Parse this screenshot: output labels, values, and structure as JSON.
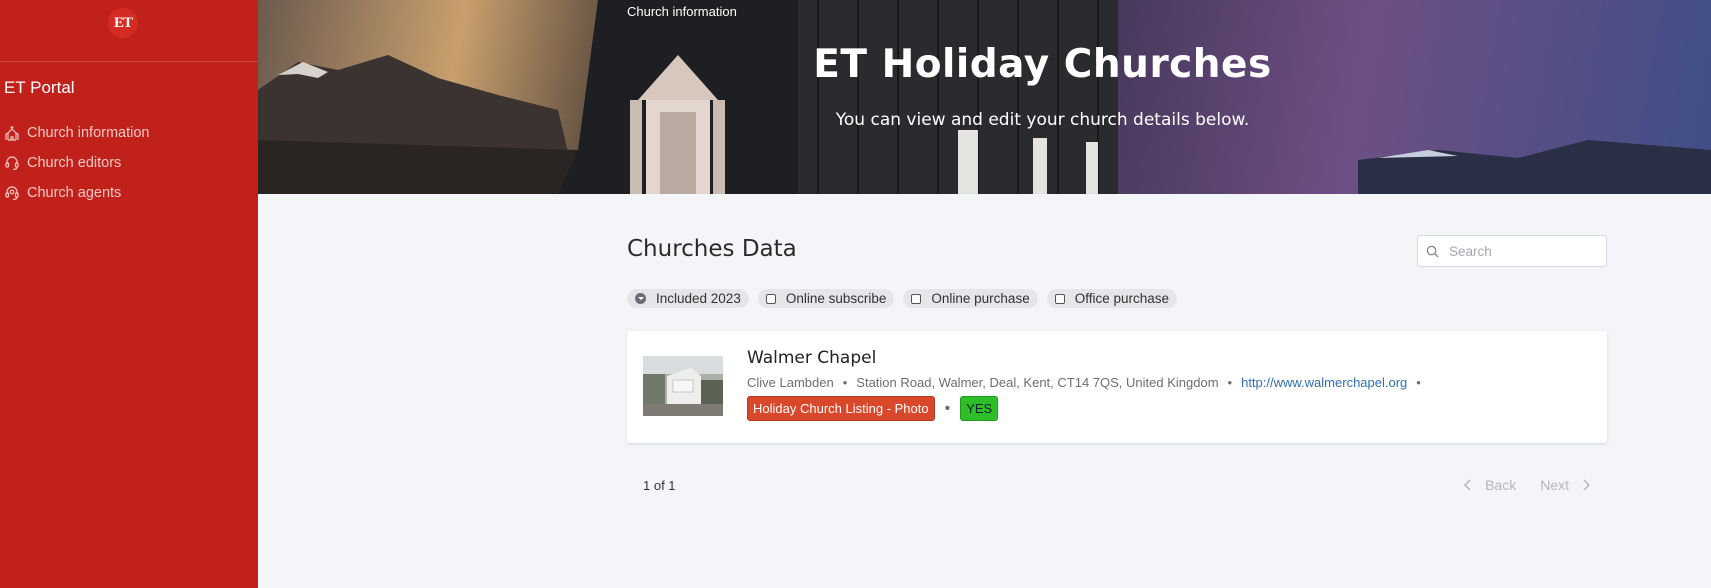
{
  "sidebar": {
    "logo_text": "ET",
    "portal_title": "ET Portal",
    "items": [
      {
        "label": "Church information",
        "icon": "church-icon"
      },
      {
        "label": "Church editors",
        "icon": "user-headset-icon"
      },
      {
        "label": "Church agents",
        "icon": "user-headset-icon"
      }
    ]
  },
  "hero": {
    "breadcrumb": "Church information",
    "title": "ET Holiday Churches",
    "subtitle": "You can view and edit your church details below."
  },
  "main": {
    "section_title": "Churches Data",
    "search_placeholder": "Search",
    "filters": [
      {
        "label": "Included 2023",
        "checked": true
      },
      {
        "label": "Online subscribe",
        "checked": false
      },
      {
        "label": "Online purchase",
        "checked": false
      },
      {
        "label": "Office purchase",
        "checked": false
      }
    ],
    "church": {
      "name": "Walmer Chapel",
      "contact": "Clive Lambden",
      "address": "Station Road, Walmer, Deal, Kent, CT14 7QS, United Kingdom",
      "website": "http://www.walmerchapel.org",
      "listing_tag": "Holiday Church Listing - Photo",
      "status_tag": "YES"
    },
    "pager": {
      "count": "1 of 1",
      "back_label": "Back",
      "next_label": "Next"
    }
  },
  "colors": {
    "sidebar_bg": "#c0221b",
    "listing_tag": "#d9482b",
    "status_tag": "#2dbe28",
    "link": "#2f6fb6"
  }
}
